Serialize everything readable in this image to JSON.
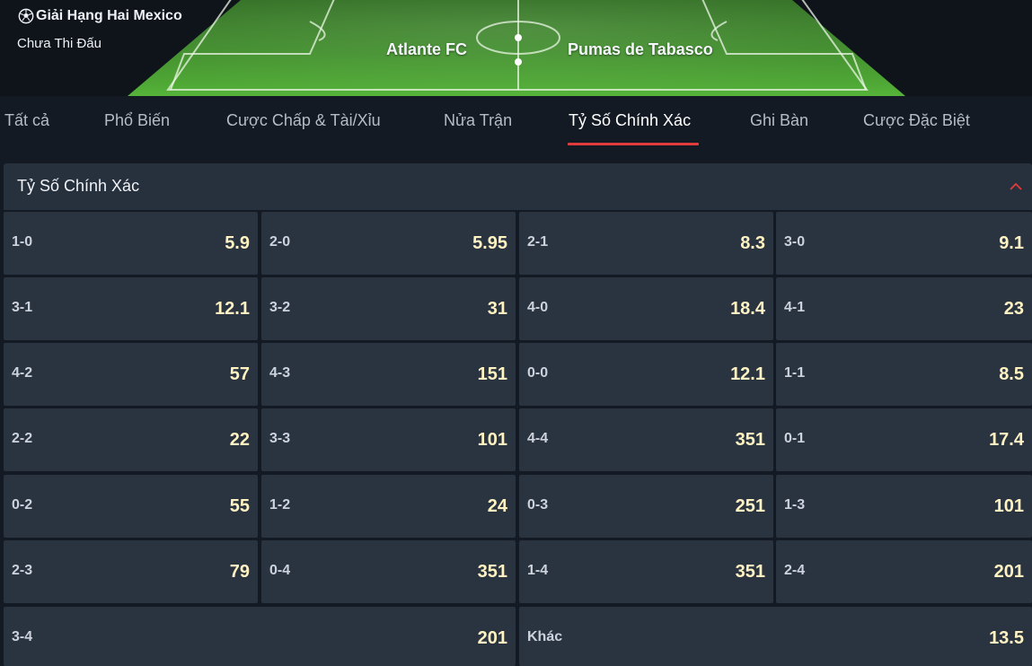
{
  "header": {
    "league": "Giải Hạng Hai Mexico",
    "status": "Chưa Thi Đấu",
    "home_team": "Atlante FC",
    "away_team": "Pumas de Tabasco"
  },
  "tabs": [
    {
      "label": "Tất cả",
      "active": false
    },
    {
      "label": "Phổ Biến",
      "active": false
    },
    {
      "label": "Cược Chấp & Tài/Xỉu",
      "active": false
    },
    {
      "label": "Nửa Trận",
      "active": false
    },
    {
      "label": "Tỷ Số Chính Xác",
      "active": true
    },
    {
      "label": "Ghi Bàn",
      "active": false
    },
    {
      "label": "Cược Đặc Biệt",
      "active": false
    }
  ],
  "section": {
    "title": "Tỷ Số Chính Xác",
    "collapse_icon": "chevron-up-icon",
    "accent_color": "#e23b3b"
  },
  "markets": [
    {
      "score": "1-0",
      "odds": "5.9"
    },
    {
      "score": "2-0",
      "odds": "5.95"
    },
    {
      "score": "2-1",
      "odds": "8.3"
    },
    {
      "score": "3-0",
      "odds": "9.1"
    },
    {
      "score": "3-1",
      "odds": "12.1"
    },
    {
      "score": "3-2",
      "odds": "31"
    },
    {
      "score": "4-0",
      "odds": "18.4"
    },
    {
      "score": "4-1",
      "odds": "23"
    },
    {
      "score": "4-2",
      "odds": "57"
    },
    {
      "score": "4-3",
      "odds": "151"
    },
    {
      "score": "0-0",
      "odds": "12.1"
    },
    {
      "score": "1-1",
      "odds": "8.5"
    },
    {
      "score": "2-2",
      "odds": "22"
    },
    {
      "score": "3-3",
      "odds": "101"
    },
    {
      "score": "4-4",
      "odds": "351"
    },
    {
      "score": "0-1",
      "odds": "17.4"
    },
    {
      "score": "0-2",
      "odds": "55"
    },
    {
      "score": "1-2",
      "odds": "24"
    },
    {
      "score": "0-3",
      "odds": "251"
    },
    {
      "score": "1-3",
      "odds": "101"
    },
    {
      "score": "2-3",
      "odds": "79"
    },
    {
      "score": "0-4",
      "odds": "351"
    },
    {
      "score": "1-4",
      "odds": "351"
    },
    {
      "score": "2-4",
      "odds": "201"
    },
    {
      "score": "3-4",
      "odds": "201"
    },
    {
      "score": "Khác",
      "odds": "13.5"
    }
  ]
}
